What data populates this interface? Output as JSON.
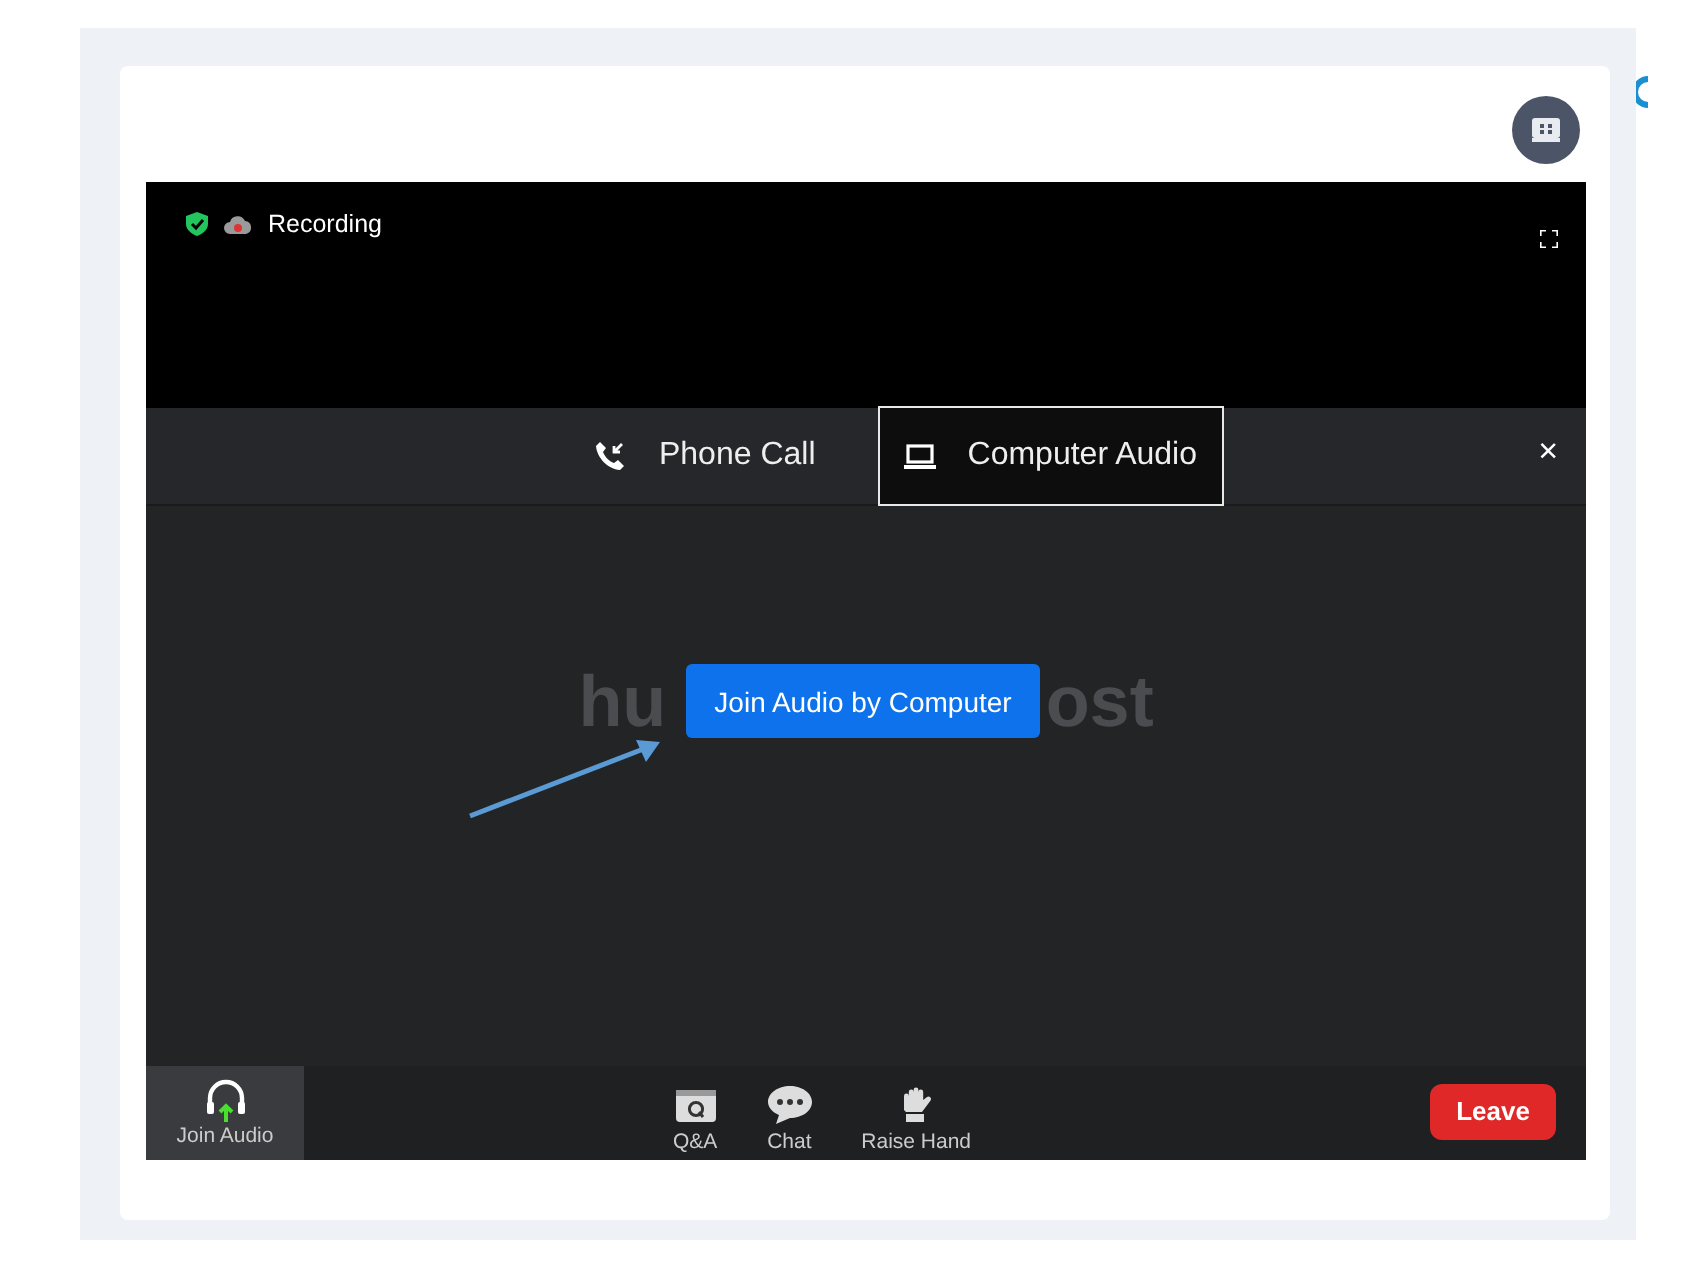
{
  "header": {
    "recording": "Recording"
  },
  "audio_tabs": [
    {
      "label": "Phone Call",
      "kind": "phone",
      "selected": false
    },
    {
      "label": "Computer Audio",
      "kind": "computer",
      "selected": true
    }
  ],
  "close": "×",
  "host_name": {
    "before": "hu",
    "after": "ost"
  },
  "join_button": "Join Audio by Computer",
  "toolbar": {
    "join_audio": "Join Audio",
    "items": [
      {
        "label": "Q&A",
        "kind": "qa"
      },
      {
        "label": "Chat",
        "kind": "chat"
      },
      {
        "label": "Raise Hand",
        "kind": "hand"
      }
    ],
    "leave": "Leave"
  }
}
